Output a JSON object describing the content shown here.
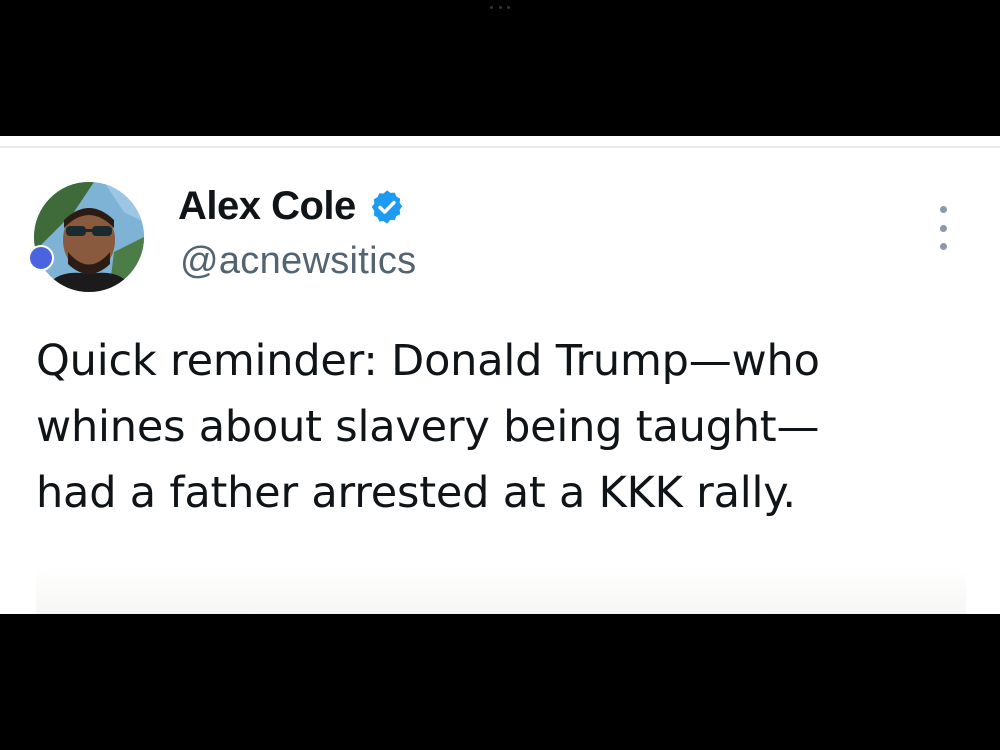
{
  "tweet": {
    "author": {
      "display_name": "Alex Cole",
      "handle": "@acnewsitics",
      "verified": true,
      "avatar_icon": "profile-photo-man-sunglasses"
    },
    "text": "Quick reminder: Donald Trump—who\nwhines about slavery being taught—\nhad a father arrested at a KKK rally.",
    "more_icon": "vertical-ellipsis-icon"
  },
  "colors": {
    "background": "#ffffff",
    "letterbox": "#000000",
    "text_primary": "#0f1419",
    "text_secondary": "#536471",
    "verified_blue": "#1d9bf0"
  }
}
